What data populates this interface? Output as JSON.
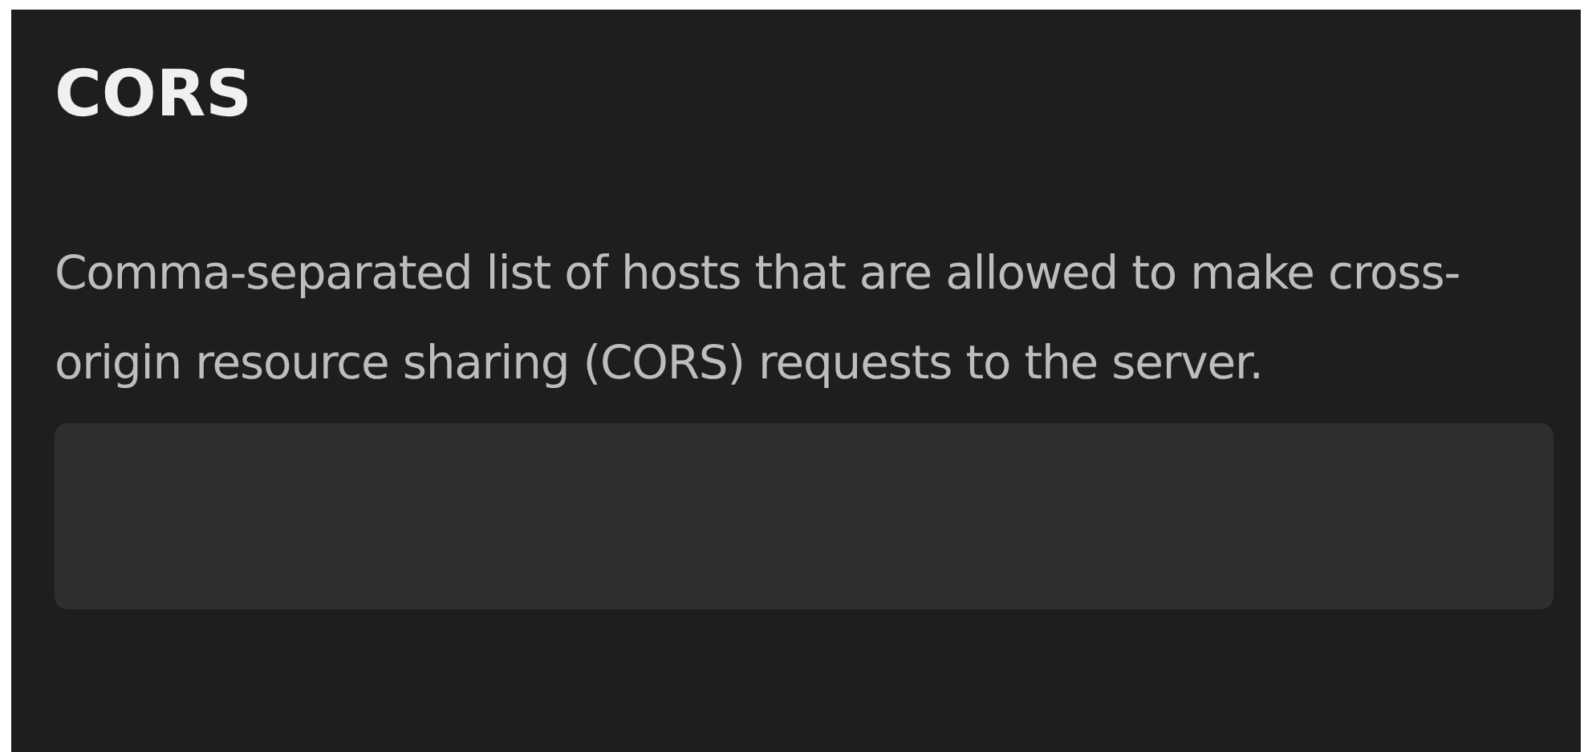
{
  "section": {
    "title": "CORS",
    "description": "Comma-separated list of hosts that are allowed to make cross-origin resource sharing (CORS) requests to the server.",
    "field": {
      "kind": "text"
    }
  }
}
